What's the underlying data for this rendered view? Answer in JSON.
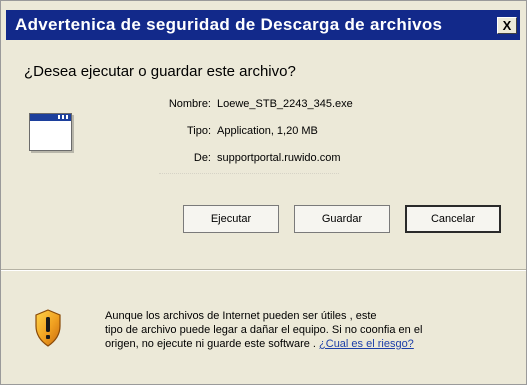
{
  "dialog": {
    "title": "Advertenica de seguridad de Descarga de archivos",
    "close_label": "X",
    "question": "¿Desea ejecutar o guardar este archivo?"
  },
  "file": {
    "name_label": "Nombre:",
    "name_value": "Loewe_STB_2243_345.exe",
    "type_label": "Tipo:",
    "type_value": "Application, 1,20 MB",
    "from_label": "De:",
    "from_value": "supportportal.ruwido.com",
    "icon": "application-window-icon"
  },
  "buttons": {
    "run": "Ejecutar",
    "save": "Guardar",
    "cancel": "Cancelar"
  },
  "warning": {
    "icon": "security-shield-icon",
    "line1": "Aunque los archivos de Internet pueden ser útiles , este",
    "line2": "tipo de archivo puede legar a dañar el equipo. Si no coonfia en el",
    "line3_text": "origen, no ejecute ni guarde este software . ",
    "link": "¿Cual es el riesgo?"
  },
  "colors": {
    "titlebar": "#12298a",
    "dialog_bg": "#ece9d8",
    "link": "#1d3fa8"
  }
}
